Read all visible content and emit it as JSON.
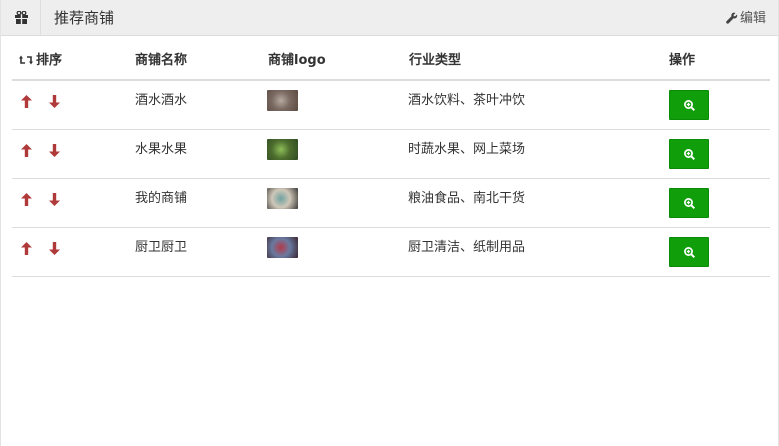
{
  "header": {
    "icon": "gift-icon",
    "title": "推荐商铺",
    "edit_label": "编辑",
    "edit_icon": "wrench-icon"
  },
  "table": {
    "columns": {
      "sort": "排序",
      "name": "商铺名称",
      "logo": "商铺logo",
      "industry": "行业类型",
      "action": "操作"
    },
    "rows": [
      {
        "name": "酒水酒水",
        "industry": "酒水饮料、茶叶冲饮",
        "logo_colors": [
          "#5a4a40",
          "#b8aaa0",
          "#7a6a62"
        ]
      },
      {
        "name": "水果水果",
        "industry": "时蔬水果、网上菜场",
        "logo_colors": [
          "#2f4a22",
          "#8fbf5a",
          "#4d6e2e"
        ]
      },
      {
        "name": "我的商铺",
        "industry": "粮油食品、南北干货",
        "logo_colors": [
          "#3b3a38",
          "#6fa2a0",
          "#cfc7b8"
        ]
      },
      {
        "name": "厨卫厨卫",
        "industry": "厨卫清洁、纸制用品",
        "logo_colors": [
          "#3a2530",
          "#b23a4a",
          "#6a7aa0"
        ]
      }
    ]
  },
  "colors": {
    "arrow": "#b03a3a",
    "view_button": "#109e0a"
  }
}
